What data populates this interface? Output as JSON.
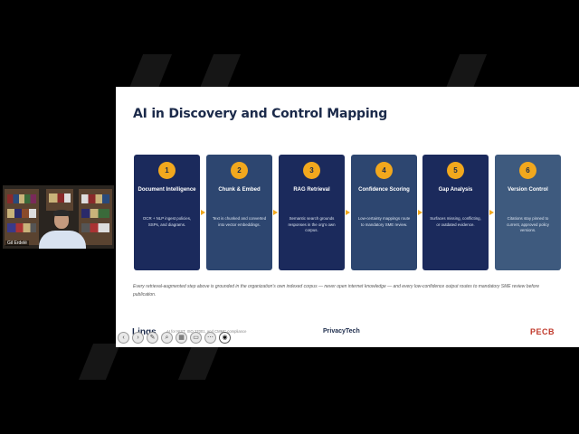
{
  "slide": {
    "title": "AI in Discovery and Control Mapping",
    "steps": [
      {
        "num": "1",
        "title": "Document Intelligence",
        "desc": "OCR + NLP ingest policies, SSPs, and diagrams."
      },
      {
        "num": "2",
        "title": "Chunk & Embed",
        "desc": "Text is chunked and converted into vector embeddings."
      },
      {
        "num": "3",
        "title": "RAG Retrieval",
        "desc": "Semantic search grounds responses in the org's own corpus."
      },
      {
        "num": "4",
        "title": "Confidence Scoring",
        "desc": "Low-certainty mappings route to mandatory SME review."
      },
      {
        "num": "5",
        "title": "Gap Analysis",
        "desc": "Surfaces missing, conflicting, or outdated evidence."
      },
      {
        "num": "6",
        "title": "Version Control",
        "desc": "Citations stay pinned to current, approved policy versions."
      }
    ],
    "footnote": "Every retrieval-augmented step above is grounded in the organization's own indexed corpus — never open internet knowledge — and every low-confidence output routes to mandatory SME review before publication.",
    "footer": {
      "logo": "Linqs",
      "sub": "AI for NIST, ISO 27001, and CMMC compliance",
      "mid": "PrivacyTech",
      "right": "PECB"
    }
  },
  "camera": {
    "name": "Gil Erdelé"
  },
  "toolbar": {
    "icons": [
      "prev-icon",
      "next-icon",
      "pen-icon",
      "zoom-icon",
      "grid-icon",
      "view-icon",
      "more-icon",
      "camera-icon"
    ]
  },
  "colors": {
    "card_dark": "#1b2a5c",
    "card_mid": "#2d4670",
    "card_light": "#3e5a7e",
    "accent": "#f2a81d"
  }
}
